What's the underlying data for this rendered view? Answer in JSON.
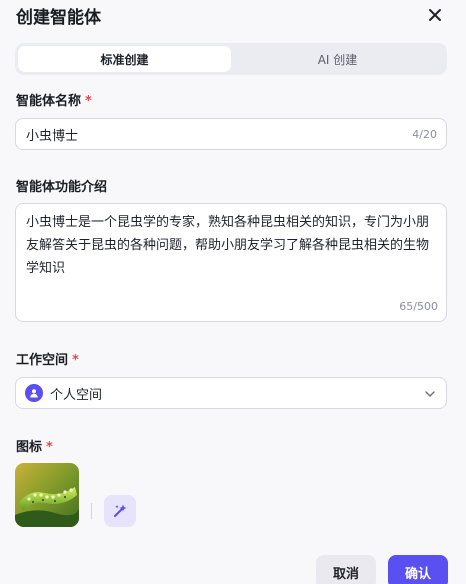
{
  "dialog": {
    "title": "创建智能体"
  },
  "tabs": [
    {
      "label": "标准创建",
      "active": true
    },
    {
      "label": "AI 创建",
      "active": false
    }
  ],
  "name_field": {
    "label": "智能体名称",
    "required_mark": "*",
    "value": "小虫博士",
    "counter": "4/20"
  },
  "description_field": {
    "label": "智能体功能介绍",
    "value": "小虫博士是一个昆虫学的专家，熟知各种昆虫相关的知识，专门为小朋友解答关于昆虫的各种问题，帮助小朋友学习了解各种昆虫相关的生物学知识",
    "counter": "65/500"
  },
  "workspace_field": {
    "label": "工作空间",
    "required_mark": "*",
    "selected": "个人空间"
  },
  "icon_field": {
    "label": "图标",
    "required_mark": "*"
  },
  "footer": {
    "cancel_label": "取消",
    "confirm_label": "确认"
  },
  "colors": {
    "accent": "#5a4ff0",
    "required": "#e5484d"
  },
  "icons": {
    "close": "close-icon",
    "workspace": "person-icon",
    "select": "chevron-down-icon",
    "generate": "sparkle-icon"
  }
}
